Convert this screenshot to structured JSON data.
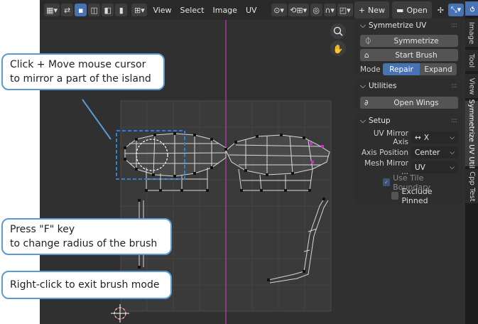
{
  "header": {
    "menus": [
      "View",
      "Select",
      "Image",
      "UV"
    ],
    "new_label": "New",
    "open_label": "Open"
  },
  "sidebar_tabs": [
    "Image",
    "Tool",
    "View",
    "Symmetrize UV Util",
    "Cpp Test"
  ],
  "panels": {
    "symmetrize": {
      "title": "Symmetrize UV",
      "symmetrize_button": "Symmetrize",
      "start_brush_button": "Start Brush",
      "mode_label": "Mode",
      "mode_options": [
        "Repair",
        "Expand"
      ],
      "mode_selected": "Repair"
    },
    "utilities": {
      "title": "Utilities",
      "open_wings_button": "Open Wings"
    },
    "setup": {
      "title": "Setup",
      "uv_mirror_axis_label": "UV Mirror Axis",
      "uv_mirror_axis_value": "X",
      "axis_position_label": "Axis Position",
      "axis_position_value": "Center",
      "mesh_mirror_label": "Mesh Mirror ...",
      "mesh_mirror_value": "UV",
      "use_tile_boundary_label": "Use Tile Boundary",
      "use_tile_boundary_checked": true,
      "exclude_pinned_label": "Exclude Pinned",
      "exclude_pinned_checked": false
    }
  },
  "callouts": {
    "mirror": [
      "Click + Move mouse cursor",
      "to mirror a part of the island"
    ],
    "radius": [
      "Press \"F\" key",
      "to change radius of the brush"
    ],
    "exit": "Right-click to exit brush mode"
  },
  "colors": {
    "accent": "#4772b3",
    "callout_border": "#5b9bd5",
    "selection_box": "#2e7fd8",
    "mirror_axis": "#c436c4"
  }
}
